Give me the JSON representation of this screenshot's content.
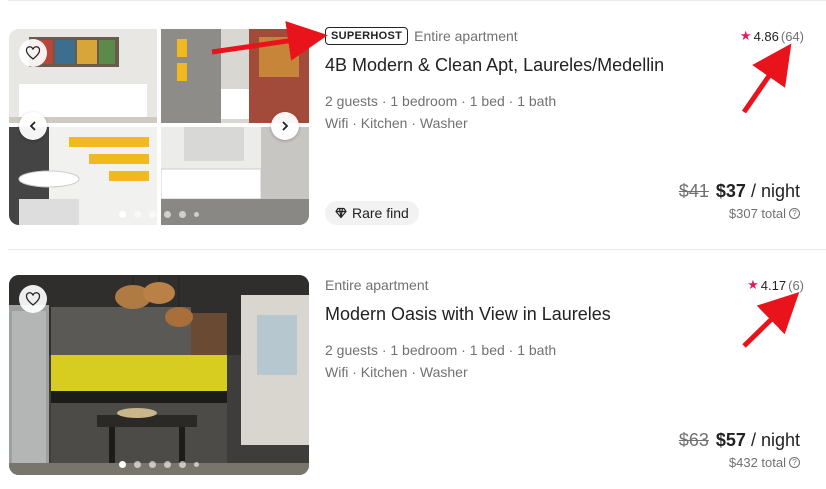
{
  "listings": [
    {
      "badge": "SUPERHOST",
      "type": "Entire apartment",
      "title": "4B Modern & Clean Apt, Laureles/Medellin",
      "details_1": "2 guests · 1 bedroom · 1 bed · 1 bath",
      "details_2": "Wifi · Kitchen · Washer",
      "rating": "4.86",
      "reviews": "(64)",
      "tag": "Rare find",
      "price_old": "$41",
      "price_new": "$37",
      "price_unit": "/ night",
      "total": "$307 total",
      "photo_dots": 6,
      "photo_dot_active": 0
    },
    {
      "badge": "",
      "type": "Entire apartment",
      "title": "Modern Oasis with View in Laureles",
      "details_1": "2 guests · 1 bedroom · 1 bed · 1 bath",
      "details_2": "Wifi · Kitchen · Washer",
      "rating": "4.17",
      "reviews": "(6)",
      "tag": "",
      "price_old": "$63",
      "price_new": "$57",
      "price_unit": "/ night",
      "total": "$432 total",
      "photo_dots": 6,
      "photo_dot_active": 0
    }
  ],
  "colors": {
    "star": "#e31c5f",
    "annotation_arrow": "#e8131b",
    "muted_text": "#717171"
  },
  "icons": [
    "heart-icon",
    "chevron-left-icon",
    "chevron-right-icon",
    "star-icon",
    "diamond-icon",
    "info-icon"
  ]
}
